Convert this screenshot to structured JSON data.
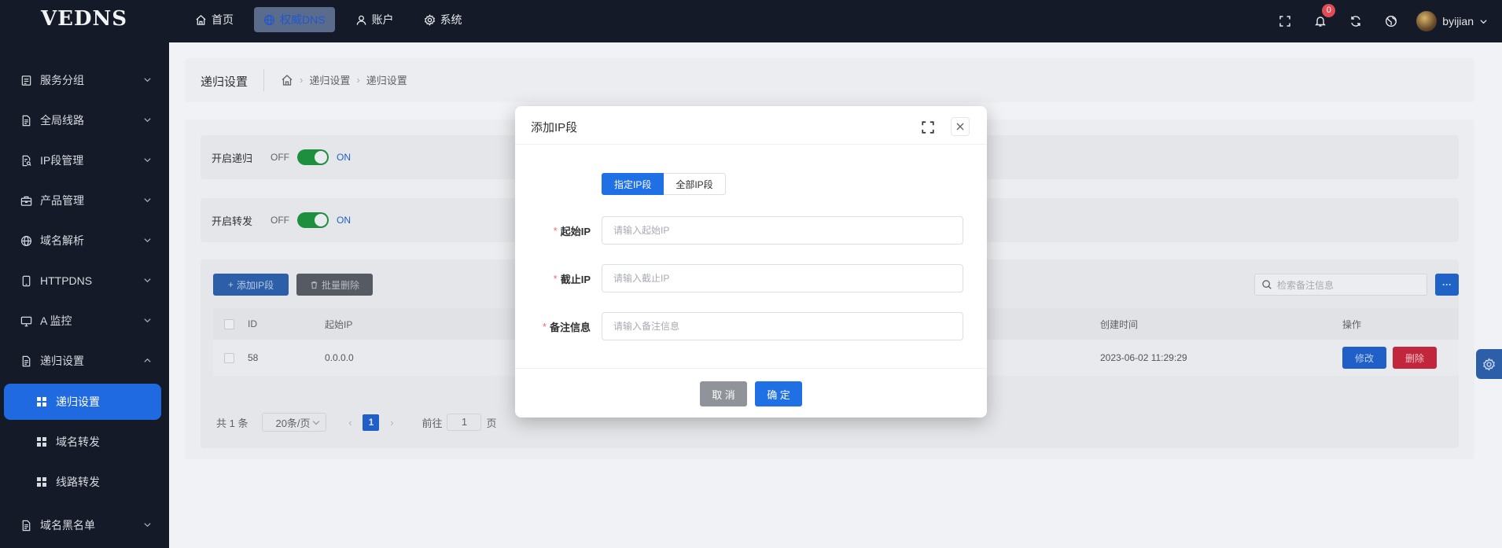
{
  "app": {
    "logo": "VEDNS"
  },
  "topnav": [
    {
      "label": "首页",
      "icon": "home-icon"
    },
    {
      "label": "权威DNS",
      "icon": "globe-icon",
      "active": true
    },
    {
      "label": "账户",
      "icon": "user-icon"
    },
    {
      "label": "系统",
      "icon": "gear-icon"
    }
  ],
  "topbar": {
    "notification_count": "0",
    "username": "byijian"
  },
  "sidebar": {
    "items": [
      {
        "label": "服务分组"
      },
      {
        "label": "全局线路"
      },
      {
        "label": "IP段管理"
      },
      {
        "label": "产品管理"
      },
      {
        "label": "域名解析"
      },
      {
        "label": "HTTPDNS"
      },
      {
        "label": "A 监控"
      },
      {
        "label": "递归设置",
        "expanded": true
      },
      {
        "label": "域名黑名单"
      }
    ],
    "sub_items": [
      {
        "label": "递归设置",
        "active": true
      },
      {
        "label": "域名转发"
      },
      {
        "label": "线路转发"
      }
    ]
  },
  "page": {
    "title": "递归设置",
    "breadcrumb": [
      "递归设置",
      "递归设置"
    ]
  },
  "switches": [
    {
      "label": "开启递归",
      "off_text": "OFF",
      "on_text": "ON",
      "state": "on"
    },
    {
      "label": "开启转发",
      "off_text": "OFF",
      "on_text": "ON",
      "state": "on"
    }
  ],
  "toolbar": {
    "add_label": "添加IP段",
    "batch_delete_label": "批量删除",
    "search_placeholder": "检索备注信息",
    "more_label": "···"
  },
  "table": {
    "columns": {
      "id": "ID",
      "start_ip": "起始IP",
      "created": "创建时间",
      "actions": "操作"
    },
    "rows": [
      {
        "id": "58",
        "start_ip": "0.0.0.0",
        "created": "2023-06-02 11:29:29",
        "edit": "修改",
        "delete": "删除"
      }
    ]
  },
  "pagination": {
    "total": "共 1 条",
    "page_size": "20条/页",
    "current_page": "1",
    "goto_prefix": "前往",
    "goto_value": "1",
    "goto_suffix": "页"
  },
  "dialog": {
    "title": "添加IP段",
    "segments": [
      "指定IP段",
      "全部IP段"
    ],
    "active_segment": "指定IP段",
    "fields": [
      {
        "label": "起始IP",
        "placeholder": "请输入起始IP",
        "required": true
      },
      {
        "label": "截止IP",
        "placeholder": "请输入截止IP",
        "required": true
      },
      {
        "label": "备注信息",
        "placeholder": "请输入备注信息",
        "required": true
      }
    ],
    "required_mark": "*",
    "cancel_label": "取 消",
    "ok_label": "确 定"
  },
  "colors": {
    "primary": "#1f6fe5",
    "sidebar_bg": "#141a27",
    "switch_on": "#1e8f3e",
    "danger": "#c2263d"
  }
}
